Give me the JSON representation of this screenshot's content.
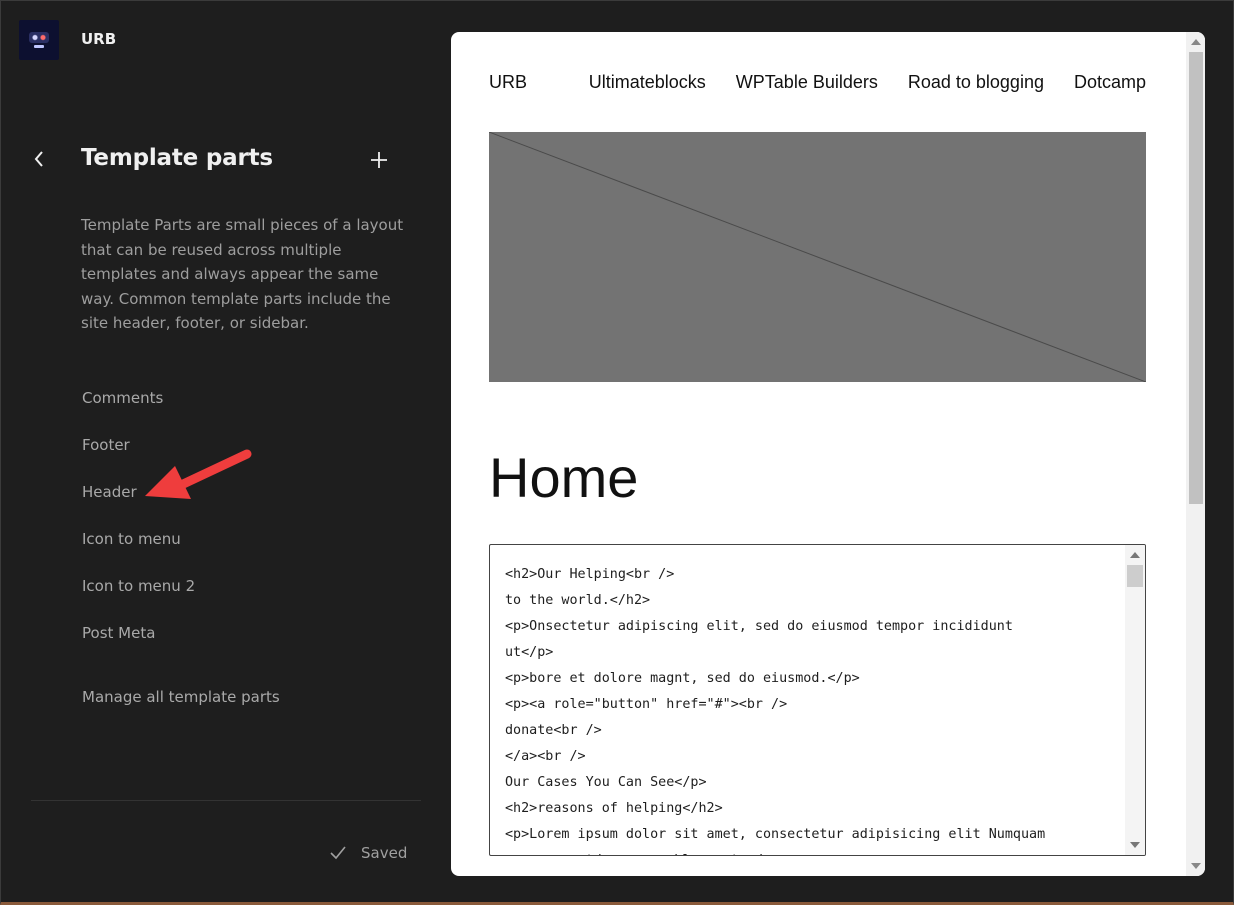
{
  "site": {
    "name": "URB",
    "logo_icon": "site-logo-icon"
  },
  "sidebar": {
    "back_icon": "chevron-left-icon",
    "title": "Template parts",
    "add_icon": "plus-icon",
    "description": "Template Parts are small pieces of a layout that can be reused across multiple templates and always appear the same way. Common template parts include the site header, footer, or sidebar.",
    "items": [
      {
        "label": "Comments"
      },
      {
        "label": "Footer"
      },
      {
        "label": "Header"
      },
      {
        "label": "Icon to menu"
      },
      {
        "label": "Icon to menu 2"
      },
      {
        "label": "Post Meta"
      }
    ],
    "manage_label": "Manage all template parts",
    "status": {
      "icon": "check-icon",
      "label": "Saved"
    }
  },
  "annotation": {
    "color": "#ef3d3d",
    "icon": "red-arrow-icon"
  },
  "preview": {
    "site_title": "URB",
    "nav": [
      {
        "label": "Ultimateblocks"
      },
      {
        "label": "WPTable Builders"
      },
      {
        "label": "Road to blogging"
      },
      {
        "label": "Dotcamp"
      }
    ],
    "image_placeholder": "image-placeholder-icon",
    "page_title": "Home",
    "code_lines": [
      "<h2>Our Helping<br />",
      "to the world.</h2>",
      "<p>Onsectetur adipiscing elit, sed do eiusmod tempor incididunt",
      "ut</p>",
      "<p>bore et dolore magnt, sed do eiusmod.</p>",
      "<p><a role=\"button\" href=\"#\"><br />",
      "donate<br />",
      "</a><br />",
      "Our Cases You Can See</p>",
      "<h2>reasons of helping</h2>",
      "<p>Lorem ipsum dolor sit amet, consectetur adipisicing elit Numquam",
      "       r  td         bl     t  /"
    ]
  },
  "colors": {
    "sidebar_bg": "#1e1e1e",
    "preview_bg": "#ffffff",
    "placeholder_bg": "#737373"
  }
}
